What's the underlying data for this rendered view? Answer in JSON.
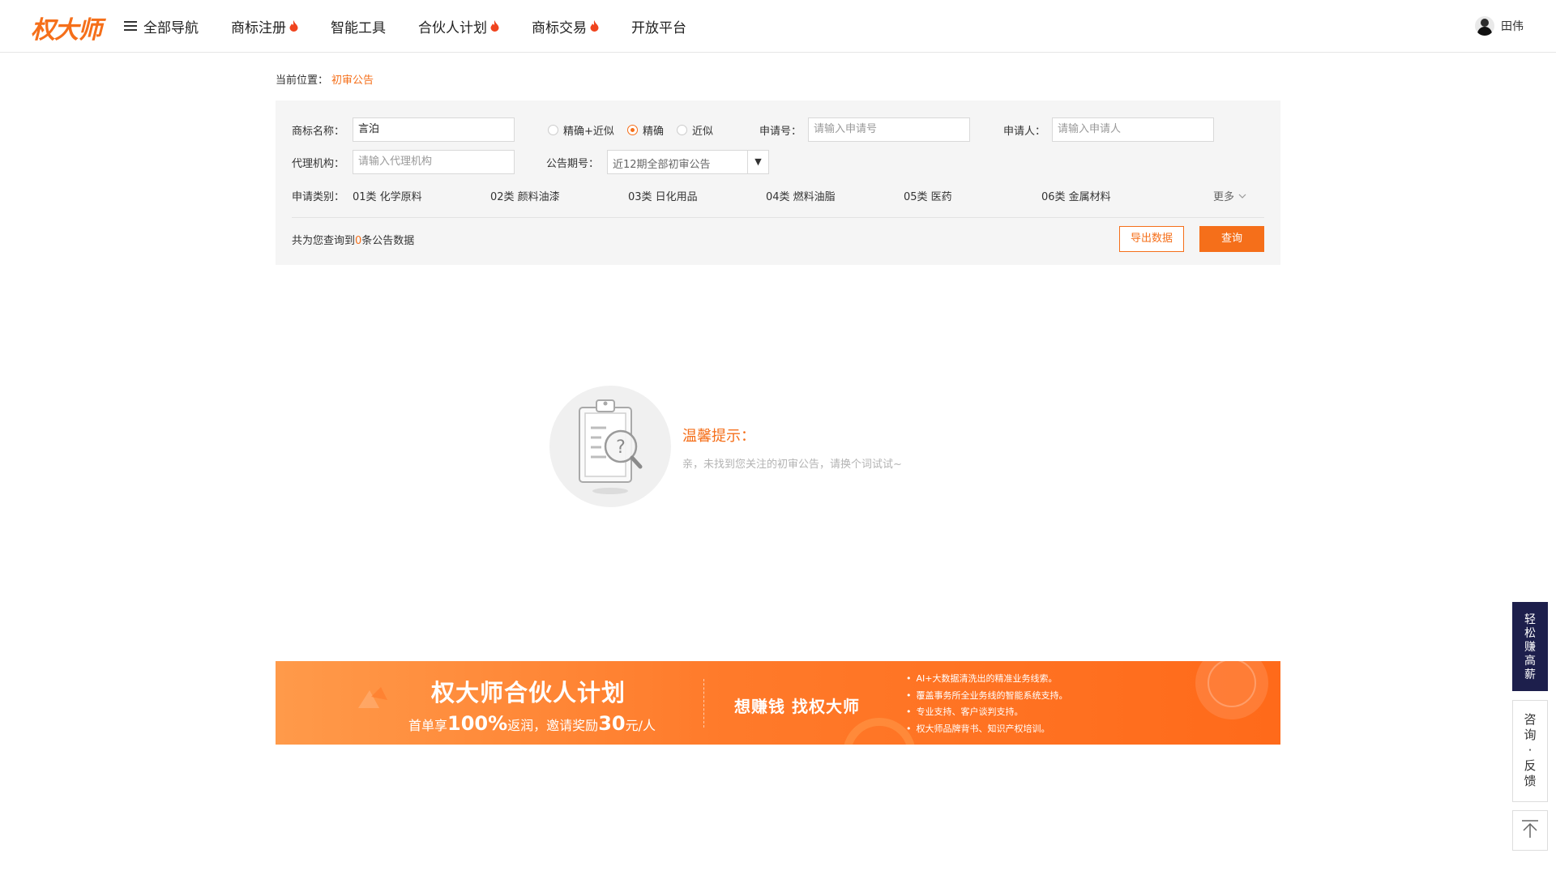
{
  "header": {
    "logo": "权大师",
    "nav": [
      {
        "label": "全部导航"
      },
      {
        "label": "商标注册"
      },
      {
        "label": "智能工具"
      },
      {
        "label": "合伙人计划"
      },
      {
        "label": "商标交易"
      },
      {
        "label": "开放平台"
      }
    ],
    "user_name": "田伟"
  },
  "breadcrumb": {
    "prefix": "当前位置：",
    "current": "初审公告"
  },
  "search": {
    "trademark_label": "商标名称：",
    "trademark_value": "言泊",
    "match_options": [
      "精确+近似",
      "精确",
      "近似"
    ],
    "match_selected": "精确",
    "appno_label": "申请号：",
    "appno_placeholder": "请输入申请号",
    "applicant_label": "申请人：",
    "applicant_placeholder": "请输入申请人",
    "agency_label": "代理机构：",
    "agency_placeholder": "请输入代理机构",
    "period_label": "公告期号：",
    "period_value": "近12期全部初审公告",
    "category_label": "申请类别：",
    "categories": [
      "01类 化学原料",
      "02类 颜料油漆",
      "03类 日化用品",
      "04类 燃料油脂",
      "05类 医药",
      "06类 金属材料"
    ],
    "more_label": "更多",
    "result_prefix": "共为您查询到",
    "result_count": "0",
    "result_suffix": "条公告数据",
    "export_label": "导出数据",
    "query_label": "查询"
  },
  "empty": {
    "title": "温馨提示：",
    "text": "亲，未找到您关注的初审公告，请换个词试试~"
  },
  "banner": {
    "title": "权大师合伙人计划",
    "sub_1": "首单享",
    "sub_2": "100%",
    "sub_3": "返润，邀请奖励",
    "sub_4": "30",
    "sub_5": "元/人",
    "slogan": "想赚钱  找权大师",
    "points": [
      "AI+大数据清洗出的精准业务线索。",
      "覆盖事务所全业务线的智能系统支持。",
      "专业支持、客户谈判支持。",
      "权大师品牌背书、知识产权培训。"
    ]
  },
  "float": {
    "earn": "轻松赚高薪",
    "consult": "咨询·反馈"
  },
  "colors": {
    "accent": "#f56f1a",
    "navy": "#1d1f4c"
  }
}
